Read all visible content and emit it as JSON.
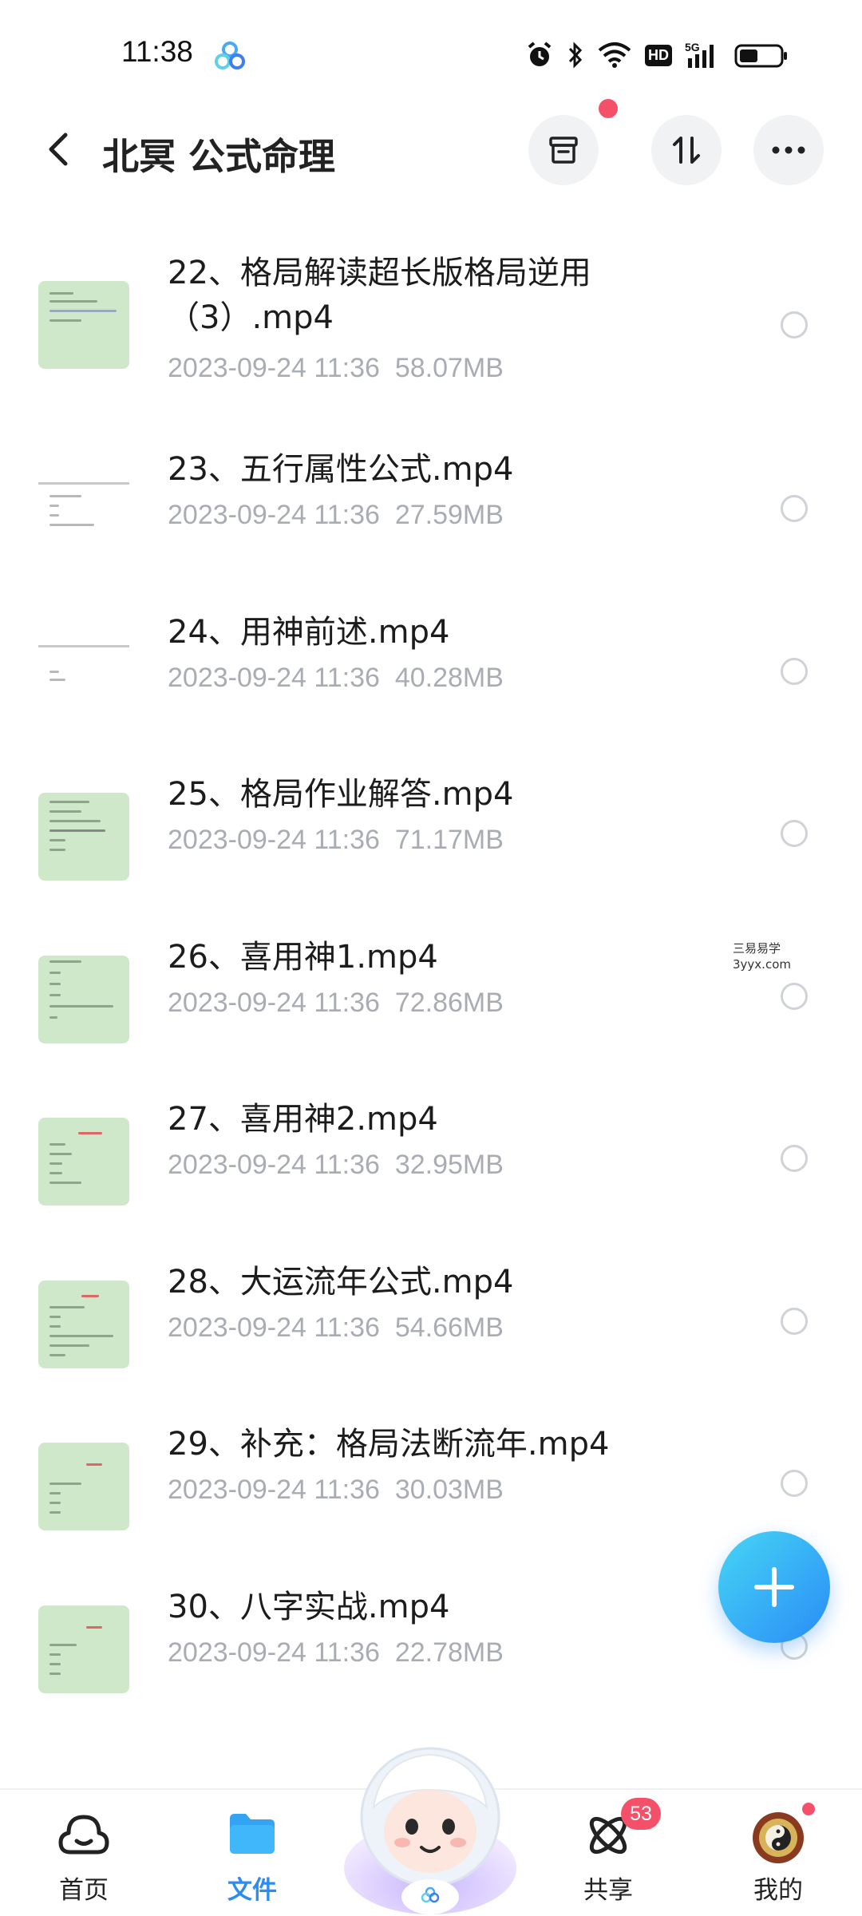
{
  "status_bar": {
    "time": "11:38",
    "icons": [
      "baidu-netdisk-icon",
      "alarm-icon",
      "bluetooth-icon",
      "wifi-icon",
      "hd-icon",
      "5g-signal-icon",
      "battery-icon"
    ],
    "hd_label": "HD"
  },
  "header": {
    "title": "北冥 公式命理",
    "actions": [
      "archive-icon",
      "sort-icon",
      "more-icon"
    ]
  },
  "files": [
    {
      "name": "22、格局解读超长版格局逆用（3）.mp4",
      "date": "2023-09-24  11:36",
      "size": "58.07MB"
    },
    {
      "name": "23、五行属性公式.mp4",
      "date": "2023-09-24  11:36",
      "size": "27.59MB"
    },
    {
      "name": "24、用神前述.mp4",
      "date": "2023-09-24  11:36",
      "size": "40.28MB"
    },
    {
      "name": "25、格局作业解答.mp4",
      "date": "2023-09-24  11:36",
      "size": "71.17MB"
    },
    {
      "name": "26、喜用神1.mp4",
      "date": "2023-09-24  11:36",
      "size": "72.86MB"
    },
    {
      "name": "27、喜用神2.mp4",
      "date": "2023-09-24  11:36",
      "size": "32.95MB"
    },
    {
      "name": "28、大运流年公式.mp4",
      "date": "2023-09-24  11:36",
      "size": "54.66MB"
    },
    {
      "name": "29、补充：格局法断流年.mp4",
      "date": "2023-09-24  11:36",
      "size": "30.03MB"
    },
    {
      "name": "30、八字实战.mp4",
      "date": "2023-09-24  11:36",
      "size": "22.78MB"
    }
  ],
  "watermark": {
    "line1": "三易易学",
    "line2": "3yyx.com"
  },
  "bottom_nav": {
    "home": "首页",
    "files": "文件",
    "share": "共享",
    "share_badge": "53",
    "mine": "我的"
  },
  "colors": {
    "accent": "#2c8cf4",
    "badge": "#f4506a",
    "meta_text": "#a9adb3",
    "thumb_green": "#cfe8c9"
  }
}
